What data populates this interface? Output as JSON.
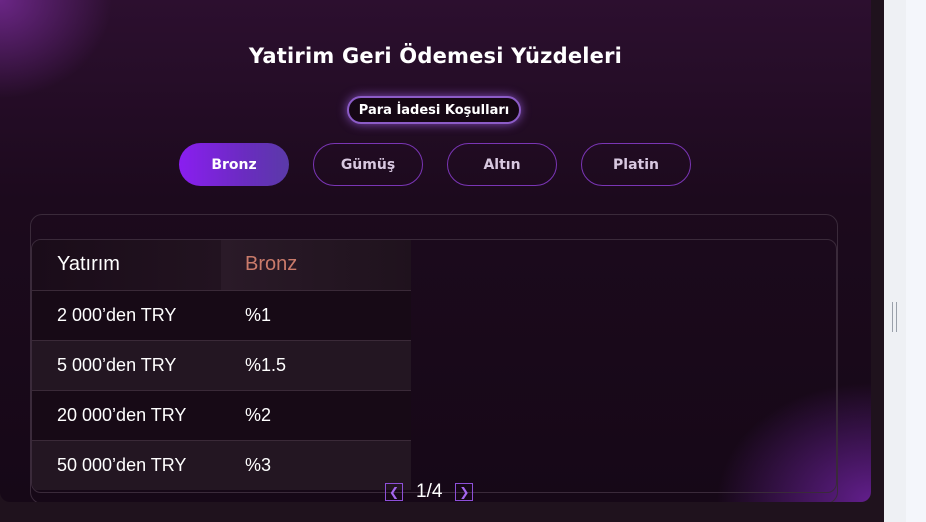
{
  "section": {
    "title": "Yatirim Geri Ödemesi Yüzdeleri",
    "conditions_label": "Para İadesi Koşulları"
  },
  "tabs": [
    {
      "label": "Bronz",
      "active": true
    },
    {
      "label": "Gümüş",
      "active": false
    },
    {
      "label": "Altın",
      "active": false
    },
    {
      "label": "Platin",
      "active": false
    }
  ],
  "table": {
    "headers": [
      "Yatırım",
      "Bronz"
    ],
    "rows": [
      [
        "2 000’den TRY",
        "%1"
      ],
      [
        "5 000’den TRY",
        "%1.5"
      ],
      [
        "20 000’den TRY",
        "%2"
      ],
      [
        "50 000’den TRY",
        "%3"
      ]
    ]
  },
  "pagination": {
    "text": "1/4",
    "prev_icon": "chevron-left-icon",
    "next_icon": "chevron-right-icon"
  },
  "colors": {
    "accent": "#8a1ef0",
    "tab_border": "#7a35b5",
    "tier_header": "#c97a6a"
  }
}
